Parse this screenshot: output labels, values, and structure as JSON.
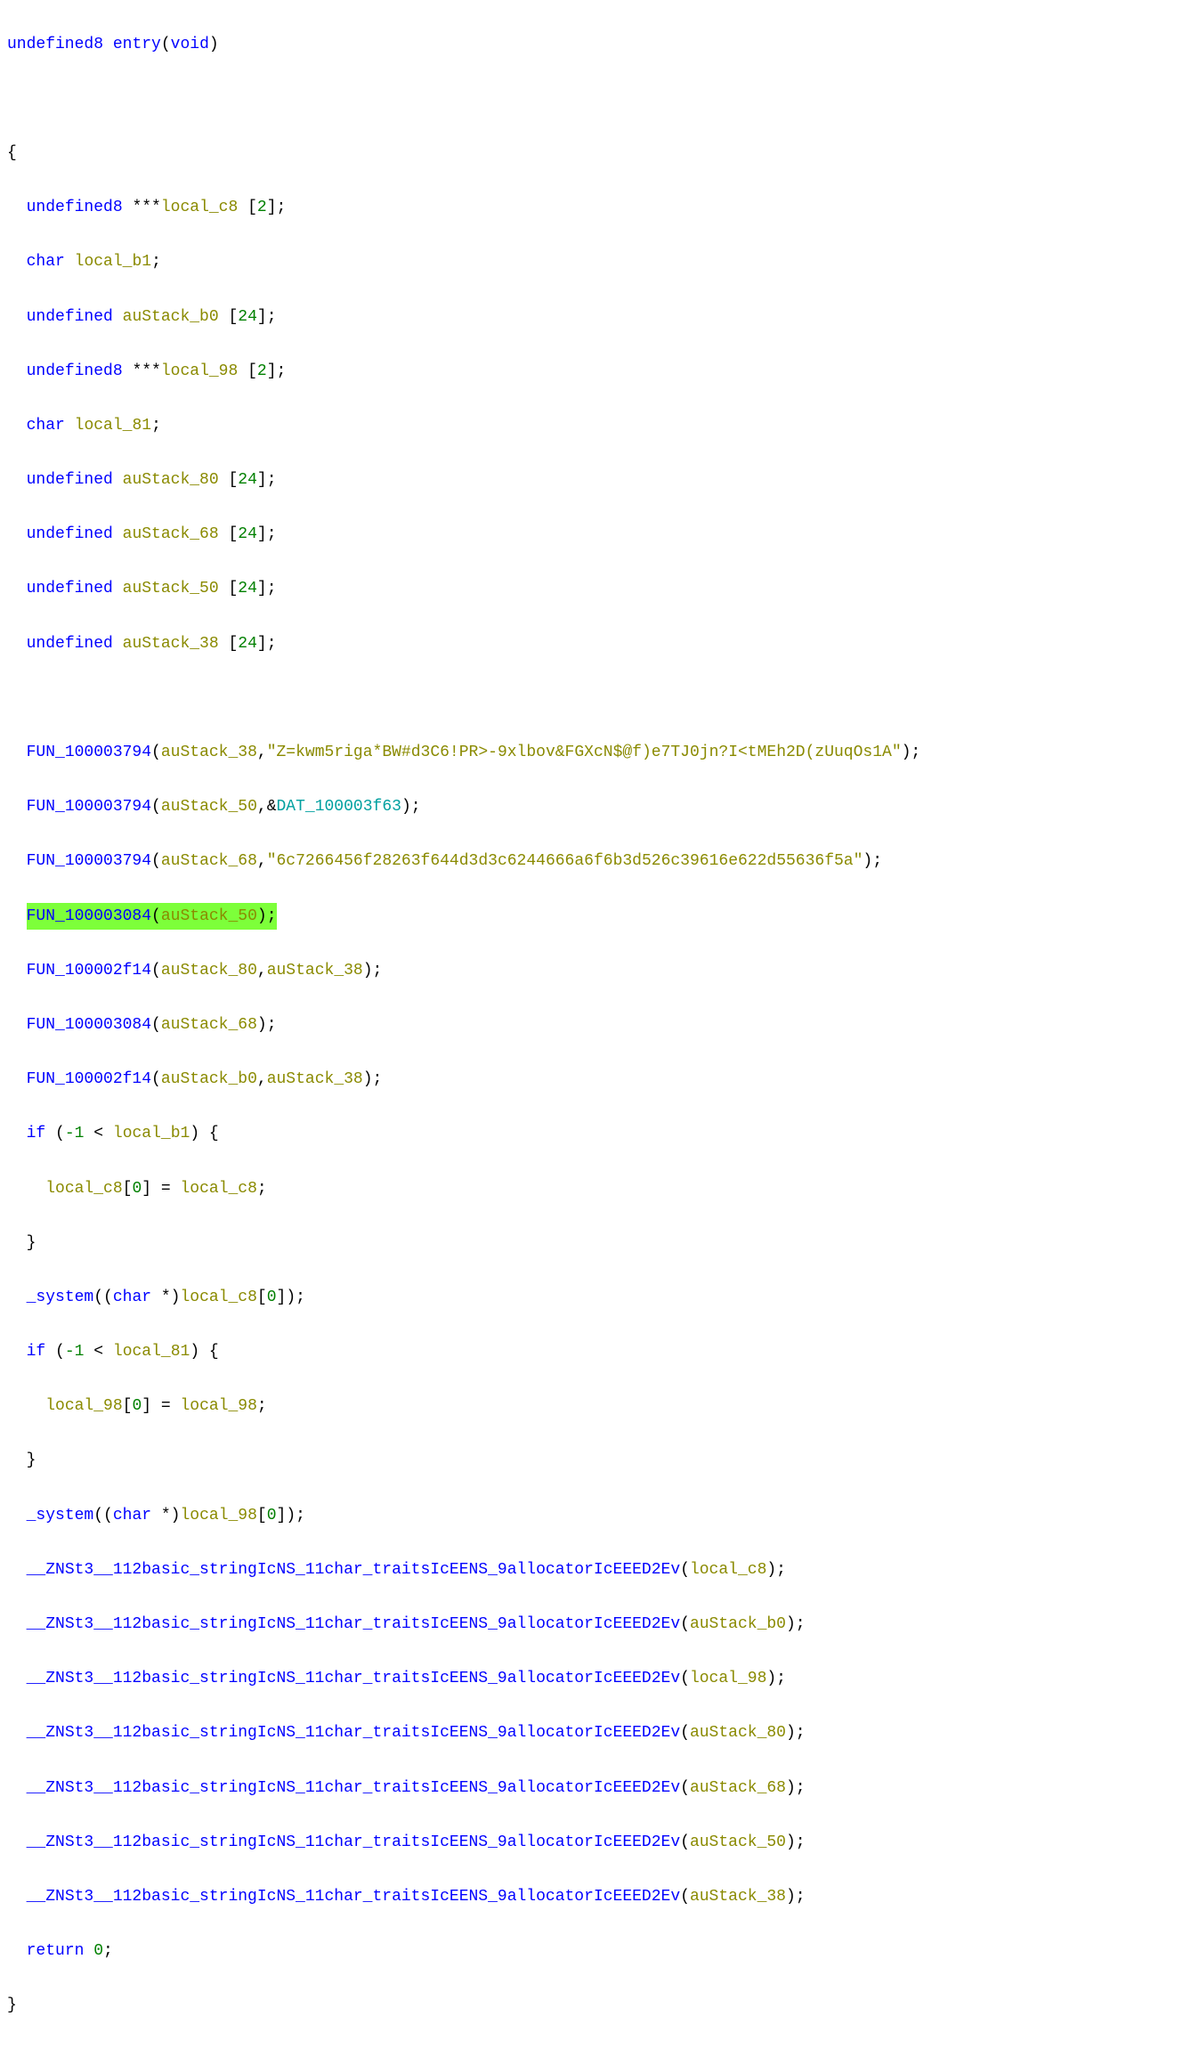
{
  "types": {
    "undefined8": "undefined8",
    "undefined": "undefined",
    "char": "char",
    "void": "void"
  },
  "fn_name": "entry",
  "decls": {
    "local_c8": "local_c8",
    "local_b1": "local_b1",
    "auStack_b0": "auStack_b0",
    "local_98": "local_98",
    "local_81": "local_81",
    "auStack_80": "auStack_80",
    "auStack_68": "auStack_68",
    "auStack_50": "auStack_50",
    "auStack_38": "auStack_38"
  },
  "nums": {
    "n2": "2",
    "n24": "24",
    "neg1": "-1",
    "zero": "0"
  },
  "funcs": {
    "FUN_100003794": "FUN_100003794",
    "FUN_100003084": "FUN_100003084",
    "FUN_100002f14": "FUN_100002f14",
    "_system": "_system",
    "zn": "__ZNSt3__112basic_stringIcNS_11char_traitsIcEENS_9allocatorIcEEED2Ev"
  },
  "refs": {
    "DAT_100003f63": "DAT_100003f63"
  },
  "strings": {
    "s1": "\"Z=kwm5riga*BW#d3C6!PR>-9xlbov&FGXcN$@f)e7TJ0jn?I<tMEh2D(zUuqOs1A\"",
    "s2": "\"6c7266456f28263f644d3d3c6244666a6f6b3d526c39616e622d55636f5a\""
  },
  "kw": {
    "if": "if",
    "return": "return"
  }
}
